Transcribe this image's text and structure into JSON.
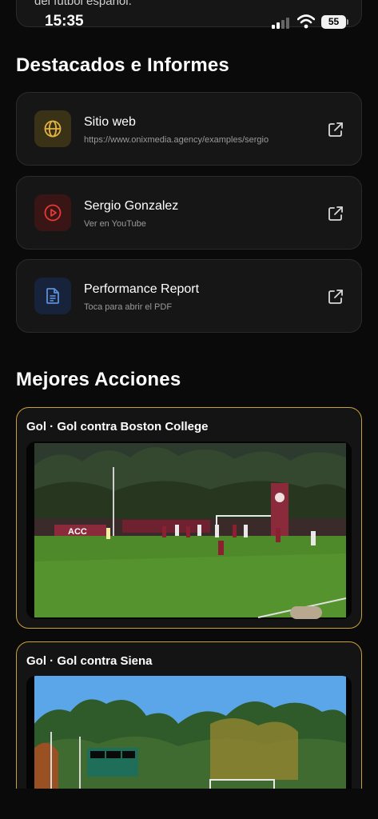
{
  "top_card": {
    "text": "del fútbol español."
  },
  "status": {
    "time": "15:35",
    "battery": "55"
  },
  "highlights": {
    "title": "Destacados e Informes",
    "items": [
      {
        "icon": "globe-icon",
        "title": "Sitio web",
        "subtitle": "https://www.onixmedia.agency/examples/sergio",
        "accent": "#e3b341"
      },
      {
        "icon": "play-circle-icon",
        "title": "Sergio Gonzalez",
        "subtitle": "Ver en YouTube",
        "accent": "#e53935"
      },
      {
        "icon": "document-icon",
        "title": "Performance Report",
        "subtitle": "Toca para abrir el PDF",
        "accent": "#5b8fd9"
      }
    ]
  },
  "actions": {
    "title": "Mejores Acciones",
    "items": [
      {
        "title": "Gol · Gol contra Boston College"
      },
      {
        "title": "Gol · Gol contra Siena"
      }
    ]
  },
  "colors": {
    "background": "#0a0a0a",
    "card": "#161616",
    "gold_border": "#c9a13a"
  }
}
